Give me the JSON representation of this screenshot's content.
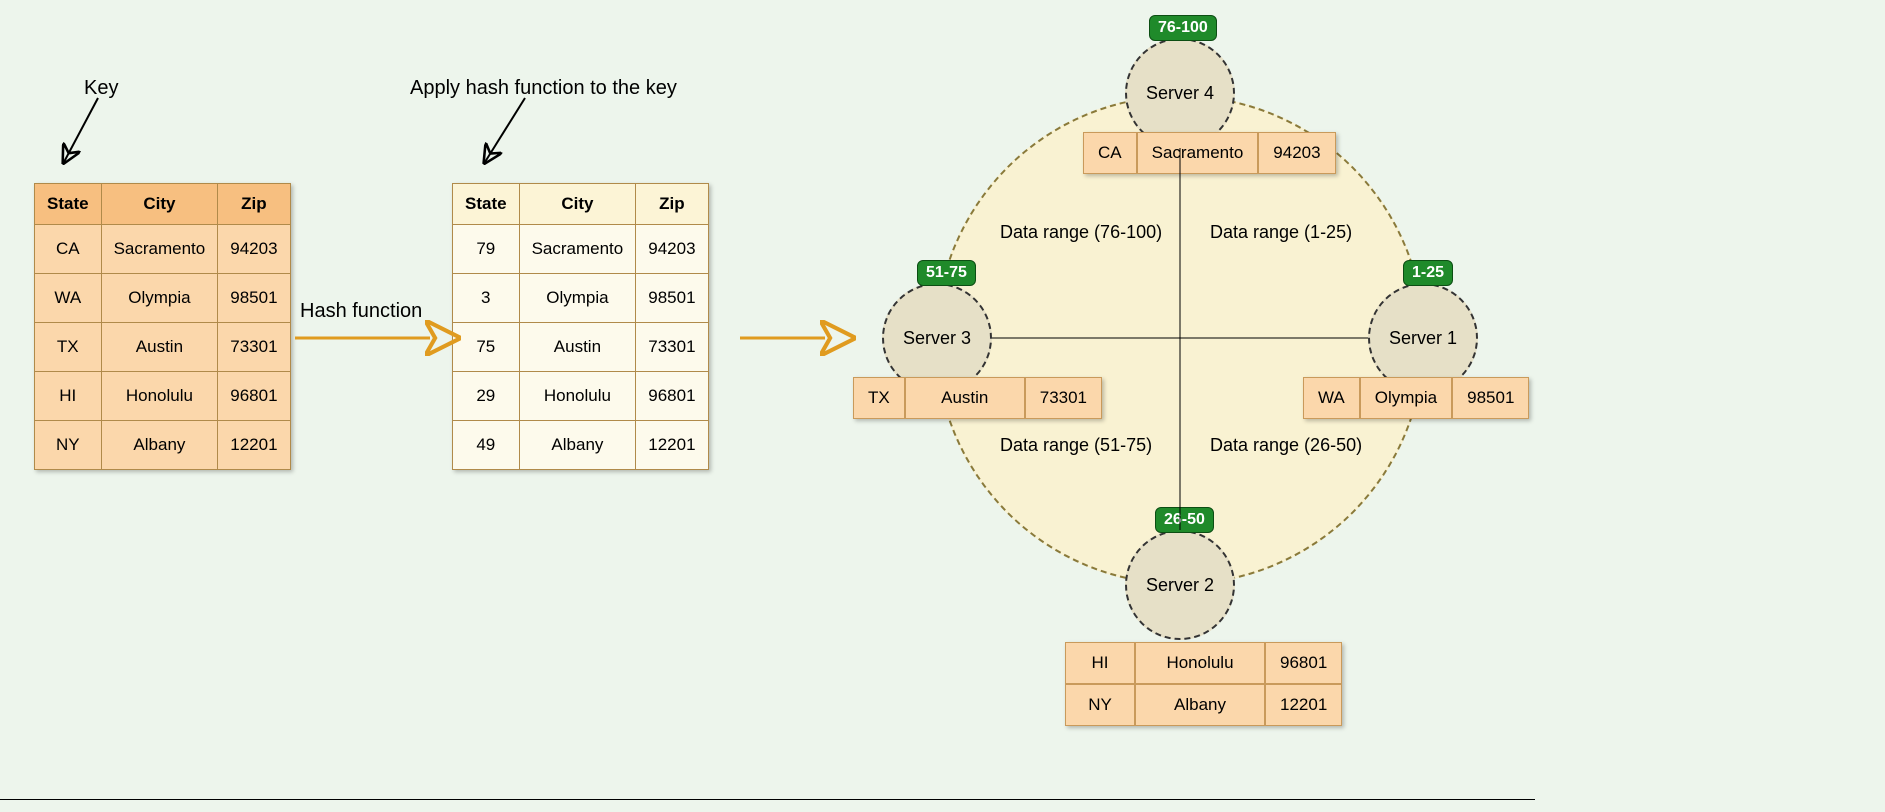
{
  "labels": {
    "key": "Key",
    "apply_hash": "Apply hash function to the key",
    "hash_function": "Hash function"
  },
  "source_table": {
    "headers": [
      "State",
      "City",
      "Zip"
    ],
    "rows": [
      [
        "CA",
        "Sacramento",
        "94203"
      ],
      [
        "WA",
        "Olympia",
        "98501"
      ],
      [
        "TX",
        "Austin",
        "73301"
      ],
      [
        "HI",
        "Honolulu",
        "96801"
      ],
      [
        "NY",
        "Albany",
        "12201"
      ]
    ]
  },
  "hashed_table": {
    "headers": [
      "State",
      "City",
      "Zip"
    ],
    "rows": [
      [
        "79",
        "Sacramento",
        "94203"
      ],
      [
        "3",
        "Olympia",
        "98501"
      ],
      [
        "75",
        "Austin",
        "73301"
      ],
      [
        "29",
        "Honolulu",
        "96801"
      ],
      [
        "49",
        "Albany",
        "12201"
      ]
    ]
  },
  "ring": {
    "servers": {
      "top": {
        "name": "Server 4",
        "badge": "76-100"
      },
      "right": {
        "name": "Server 1",
        "badge": "1-25"
      },
      "bottom": {
        "name": "Server 2",
        "badge": "26-50"
      },
      "left": {
        "name": "Server 3",
        "badge": "51-75"
      }
    },
    "quadrants": {
      "tl": "Data range (76-100)",
      "tr": "Data range (1-25)",
      "bl": "Data range (51-75)",
      "br": "Data range (26-50)"
    },
    "server_data": {
      "top": [
        [
          "CA",
          "Sacramento",
          "94203"
        ]
      ],
      "right": [
        [
          "WA",
          "Olympia",
          "98501"
        ]
      ],
      "bottom": [
        [
          "HI",
          "Honolulu",
          "96801"
        ],
        [
          "NY",
          "Albany",
          "12201"
        ]
      ],
      "left": [
        [
          "TX",
          "Austin",
          "73301"
        ]
      ]
    }
  }
}
